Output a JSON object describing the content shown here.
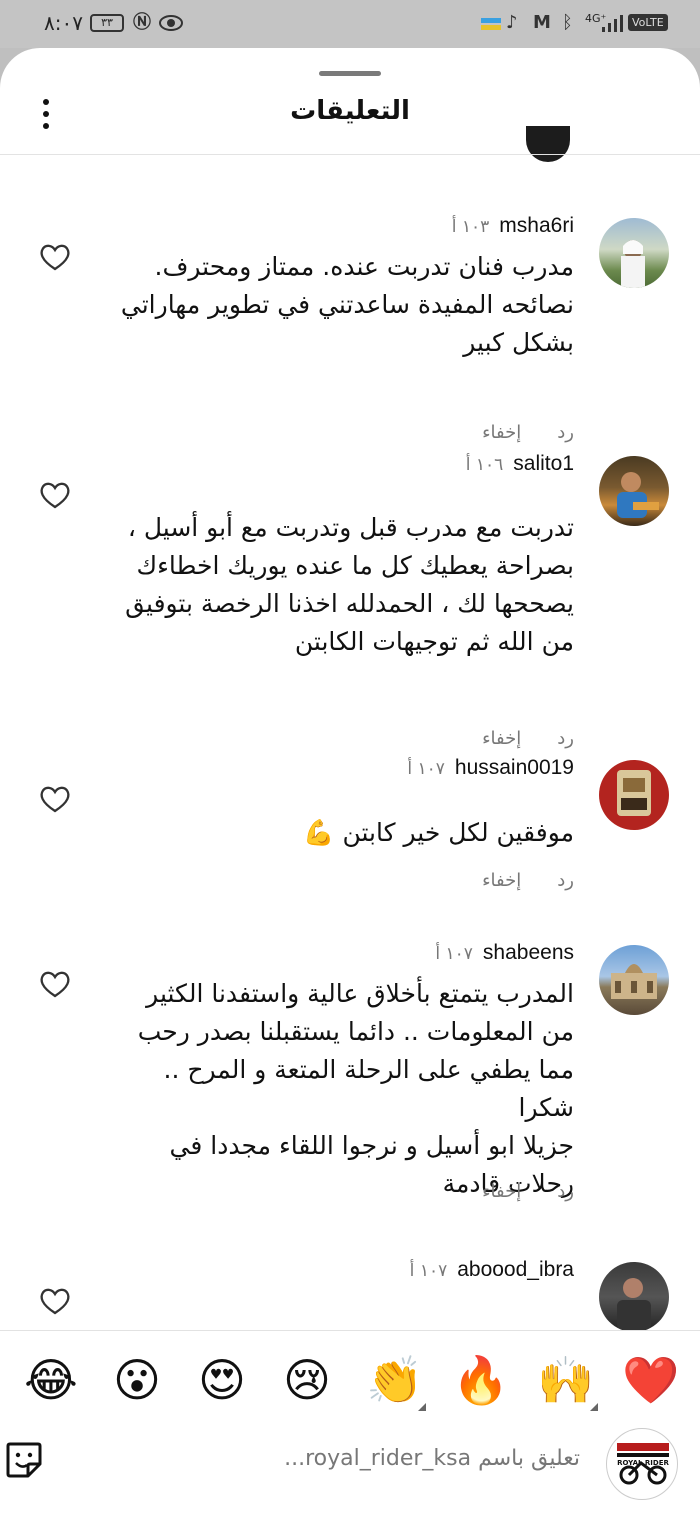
{
  "status_bar": {
    "time": "٨:٠٧",
    "battery": "٣٣",
    "network": "4G⁺",
    "volte": "VoLTE",
    "icons": [
      "battery-icon",
      "nfc-icon",
      "eye-icon",
      "tiktok-icon",
      "gmail-icon",
      "bluetooth-icon",
      "signal-icon"
    ]
  },
  "sheet": {
    "title": "التعليقات",
    "more_icon": "more-vertical-icon"
  },
  "comments": [
    {
      "username": "msha6ri",
      "time": "١٠٣ أ",
      "text": "مدرب فنان تدربت عنده. ممتاز ومحترف.\nنصائحه المفيدة ساعدتني في تطوير مهاراتي\nبشكل كبير",
      "reply": "رد",
      "hide": "إخفاء"
    },
    {
      "username": "salito1",
      "time": "١٠٦ أ",
      "text": "تدربت مع مدرب قبل وتدربت مع أبو أسيل ،\nبصراحة يعطيك كل ما عنده يوريك اخطاءك\nيصححها لك ، الحمدلله اخذنا الرخصة بتوفيق\nمن الله ثم توجيهات الكابتن",
      "reply": "رد",
      "hide": "إخفاء"
    },
    {
      "username": "hussain0019",
      "time": "١٠٧ أ",
      "text": "موفقين لكل خير كابتن 💪",
      "reply": "رد",
      "hide": "إخفاء"
    },
    {
      "username": "shabeens",
      "time": "١٠٧ أ",
      "text": "المدرب يتمتع بأخلاق عالية واستفدنا الكثير\nمن المعلومات .. دائما يستقبلنا بصدر رحب\nمما يطفي على الرحلة المتعة و المرح .. شكرا\nجزيلا ابو أسيل و نرجوا اللقاء مجددا في\nرحلات قادمة",
      "reply": "رد",
      "hide": "إخفاء"
    },
    {
      "username": "aboood_ibra",
      "time": "١٠٧ أ",
      "text": "",
      "reply": "",
      "hide": ""
    }
  ],
  "emoji_bar": [
    "😂",
    "😮",
    "😍",
    "😢",
    "👏",
    "🔥",
    "🙌",
    "❤️"
  ],
  "input_bar": {
    "placeholder": "تعليق باسم royal_rider_ksa...",
    "sticker_icon": "sticker-icon",
    "logo_text": "ROYAL RIDER"
  },
  "colors": {
    "background_dim": "#bfbfbf",
    "heart_red": "#e0242c",
    "muted_text": "#777777"
  }
}
